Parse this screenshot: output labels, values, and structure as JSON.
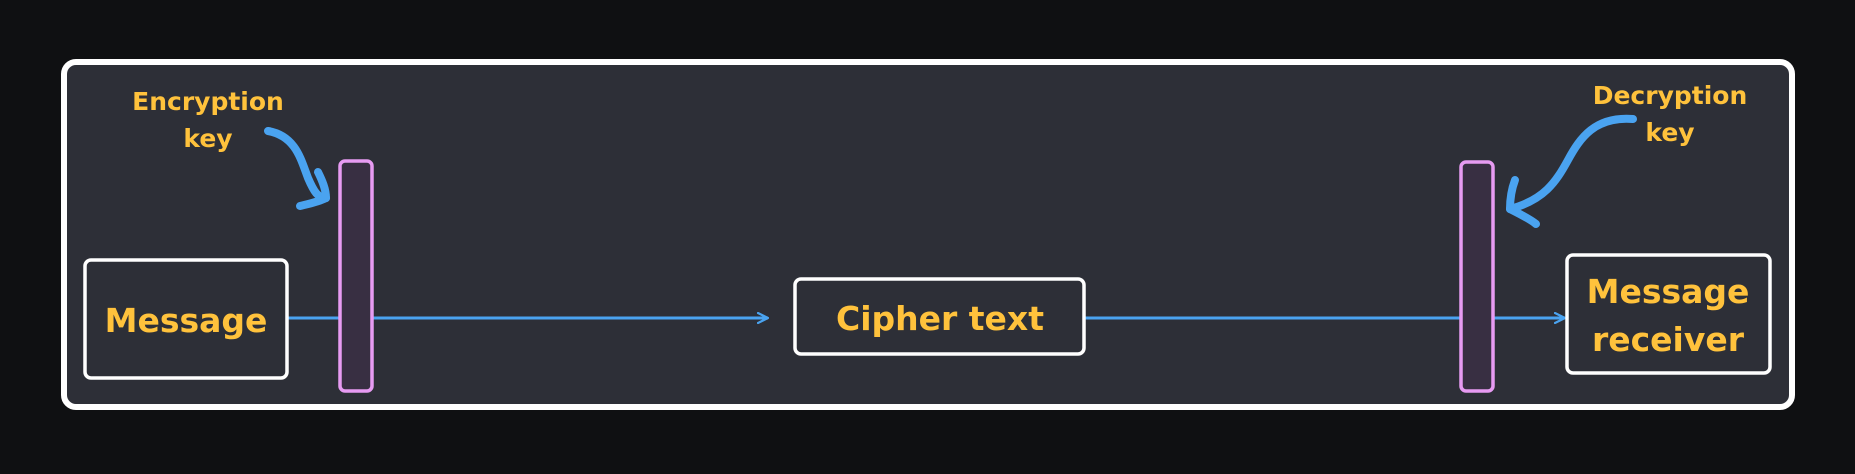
{
  "diagram": {
    "nodes": {
      "message": {
        "label": "Message"
      },
      "cipher": {
        "label": "Cipher text"
      },
      "receiver": {
        "line1": "Message",
        "line2": "receiver"
      }
    },
    "annotations": {
      "encryption_key": {
        "line1": "Encryption",
        "line2": "key"
      },
      "decryption_key": {
        "line1": "Decryption",
        "line2": "key"
      }
    },
    "colors": {
      "background": "#0f1012",
      "panel": "#2d2f37",
      "frame": "#ffffff",
      "text": "#ffc23c",
      "arrow": "#4aa3f0",
      "key_bar_stroke": "#e79bf2",
      "key_bar_fill": "#382f42"
    }
  }
}
